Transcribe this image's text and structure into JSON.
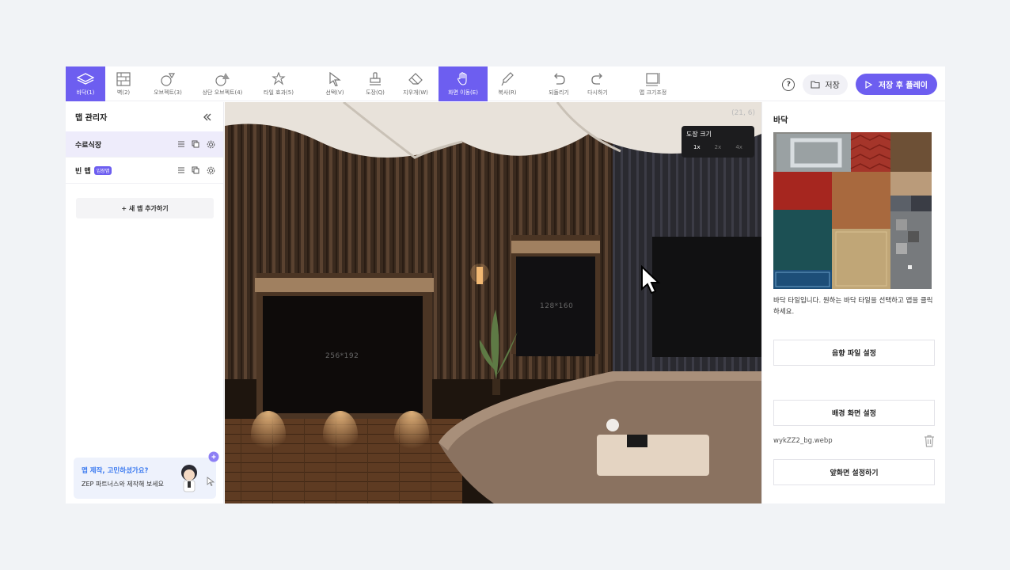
{
  "toolbar": {
    "tools": [
      {
        "label": "바닥(1)",
        "icon": "floor-icon"
      },
      {
        "label": "벽(2)",
        "icon": "wall-icon"
      },
      {
        "label": "오브젝트(3)",
        "icon": "object-icon"
      },
      {
        "label": "상단 오브젝트(4)",
        "icon": "top-object-icon"
      },
      {
        "label": "타일 효과(5)",
        "icon": "tile-effect-icon"
      },
      {
        "label": "선택(V)",
        "icon": "select-cursor-icon"
      },
      {
        "label": "도장(Q)",
        "icon": "stamp-icon"
      },
      {
        "label": "지우개(W)",
        "icon": "eraser-icon"
      },
      {
        "label": "화면 이동(E)",
        "icon": "hand-icon"
      },
      {
        "label": "복사(R)",
        "icon": "eyedropper-icon"
      },
      {
        "label": "되돌리기",
        "icon": "undo-icon"
      },
      {
        "label": "다시하기",
        "icon": "redo-icon"
      },
      {
        "label": "맵 크기조정",
        "icon": "resize-icon"
      }
    ],
    "save_label": "저장",
    "save_play_label": "저장 후 플레이",
    "help_icon_label": "?"
  },
  "left": {
    "title": "맵 관리자",
    "maps": [
      {
        "name": "수료식장",
        "badge": ""
      },
      {
        "name": "빈 맵",
        "badge": "입장맵"
      }
    ],
    "add_map_label": "+ 새 맵 추가하기",
    "promo_line1": "맵 제작, 고민하셨가요?",
    "promo_line2": "ZEP 파트너스와 제작해 보세요"
  },
  "canvas": {
    "coord": "(21, 6)",
    "brush_title": "도장 크기",
    "brush_sizes": [
      "1x",
      "2x",
      "4x"
    ],
    "brush_selected": "1x",
    "label_large": "256*192",
    "label_small": "128*160"
  },
  "right": {
    "title": "바닥",
    "description": "바닥 타일입니다. 원하는 바닥 타일을 선택하고 맵을 클릭하세요.",
    "sound_button": "음향 파일 설정",
    "bg_button": "배경 화면 설정",
    "bg_file": "wykZZ2_bg.webp",
    "fg_button": "앞화면 설정하기"
  },
  "colors": {
    "accent": "#6d5ef0",
    "promo_text": "#3b7af0"
  }
}
